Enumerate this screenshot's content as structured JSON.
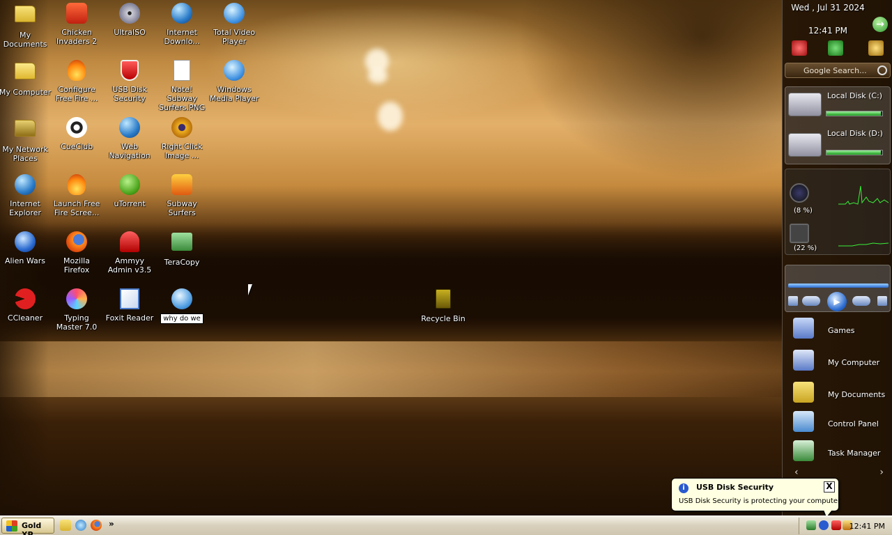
{
  "desktop": {
    "icons": [
      {
        "label": "My Documents",
        "icon": "my-documents-icon"
      },
      {
        "label": "Chicken Invaders 2",
        "icon": "chicken-invaders-icon"
      },
      {
        "label": "UltraISO",
        "icon": "ultraiso-icon"
      },
      {
        "label": "Internet Downlo...",
        "icon": "internet-download-manager-icon"
      },
      {
        "label": "Total Video Player",
        "icon": "total-video-player-icon"
      },
      {
        "label": "My Computer",
        "icon": "my-computer-icon"
      },
      {
        "label": "Configure Free Fire ...",
        "icon": "free-fire-icon"
      },
      {
        "label": "USB Disk Security",
        "icon": "usb-disk-security-icon"
      },
      {
        "label": "Note! Subway Surfers.PNG",
        "icon": "png-file-icon"
      },
      {
        "label": "Windows Media Player",
        "icon": "windows-media-player-icon"
      },
      {
        "label": "My Network Places",
        "icon": "network-places-icon"
      },
      {
        "label": "CueClub",
        "icon": "cueclub-icon"
      },
      {
        "label": "Web Navigation",
        "icon": "globe-icon"
      },
      {
        "label": "Right Click Image ...",
        "icon": "gear-icon"
      },
      {
        "label": "Internet Explorer",
        "icon": "internet-explorer-icon"
      },
      {
        "label": "Launch Free Fire Scree...",
        "icon": "free-fire-icon"
      },
      {
        "label": "uTorrent",
        "icon": "utorrent-icon"
      },
      {
        "label": "Subway Surfers",
        "icon": "subway-surfers-icon"
      },
      {
        "label": "Alien Wars",
        "icon": "alien-wars-icon"
      },
      {
        "label": "Mozilla Firefox",
        "icon": "firefox-icon"
      },
      {
        "label": "Ammyy Admin v3.5",
        "icon": "ammyy-admin-icon"
      },
      {
        "label": "TeraCopy",
        "icon": "teracopy-icon"
      },
      {
        "label": "CCleaner",
        "icon": "ccleaner-icon"
      },
      {
        "label": "Typing Master 7.0",
        "icon": "typing-master-icon"
      },
      {
        "label": "Foxit Reader",
        "icon": "foxit-reader-icon"
      },
      {
        "label": "why do we",
        "icon": "link-icon"
      },
      {
        "label": "Recycle Bin",
        "icon": "recycle-bin-icon"
      }
    ]
  },
  "sidebar": {
    "date": "Wed , Jul 31 2024",
    "time": "12:41 PM",
    "search_placeholder": "Google Search...",
    "drives": [
      {
        "label": "Local Disk (C:)",
        "usage": 0.97
      },
      {
        "label": "Local Disk (D:)",
        "usage": 0.97
      }
    ],
    "cpu_percent": "(8 %)",
    "ram_percent": "(22 %)",
    "player_progress": 1.0,
    "links": [
      {
        "label": "Games"
      },
      {
        "label": "My Computer"
      },
      {
        "label": "My Documents"
      },
      {
        "label": "Control Panel"
      },
      {
        "label": "Task Manager"
      }
    ]
  },
  "balloon": {
    "title": "USB Disk Security",
    "text": "USB Disk Security is protecting your computer",
    "close": "X"
  },
  "taskbar": {
    "start_label": "Gold XP",
    "more": "»",
    "clock": "12:41 PM"
  },
  "colors": {
    "wallpaper_tone": "#c08a42",
    "balloon_bg": "#ffffe1",
    "taskbar_bg": "#d8d0bc"
  }
}
